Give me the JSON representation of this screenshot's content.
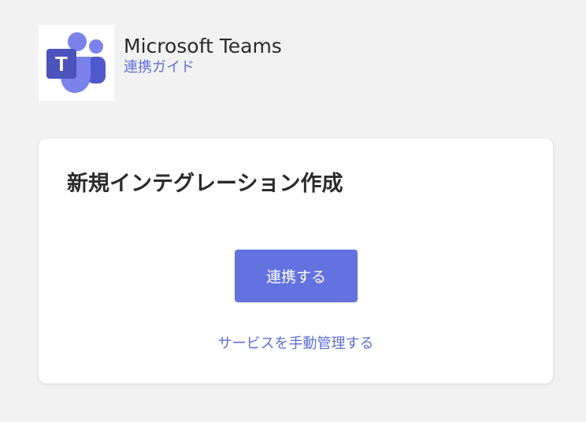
{
  "app": {
    "title": "Microsoft Teams",
    "guide_link": "連携ガイド",
    "logo_letter": "T",
    "brand_color": "#5059C9",
    "brand_light": "#7B83EB"
  },
  "card": {
    "title": "新規インテグレーション作成",
    "connect_button": "連携する",
    "manual_link": "サービスを手動管理する"
  },
  "colors": {
    "accent": "#6472e0",
    "link": "#5f6fd6",
    "background": "#f2f2f2"
  }
}
